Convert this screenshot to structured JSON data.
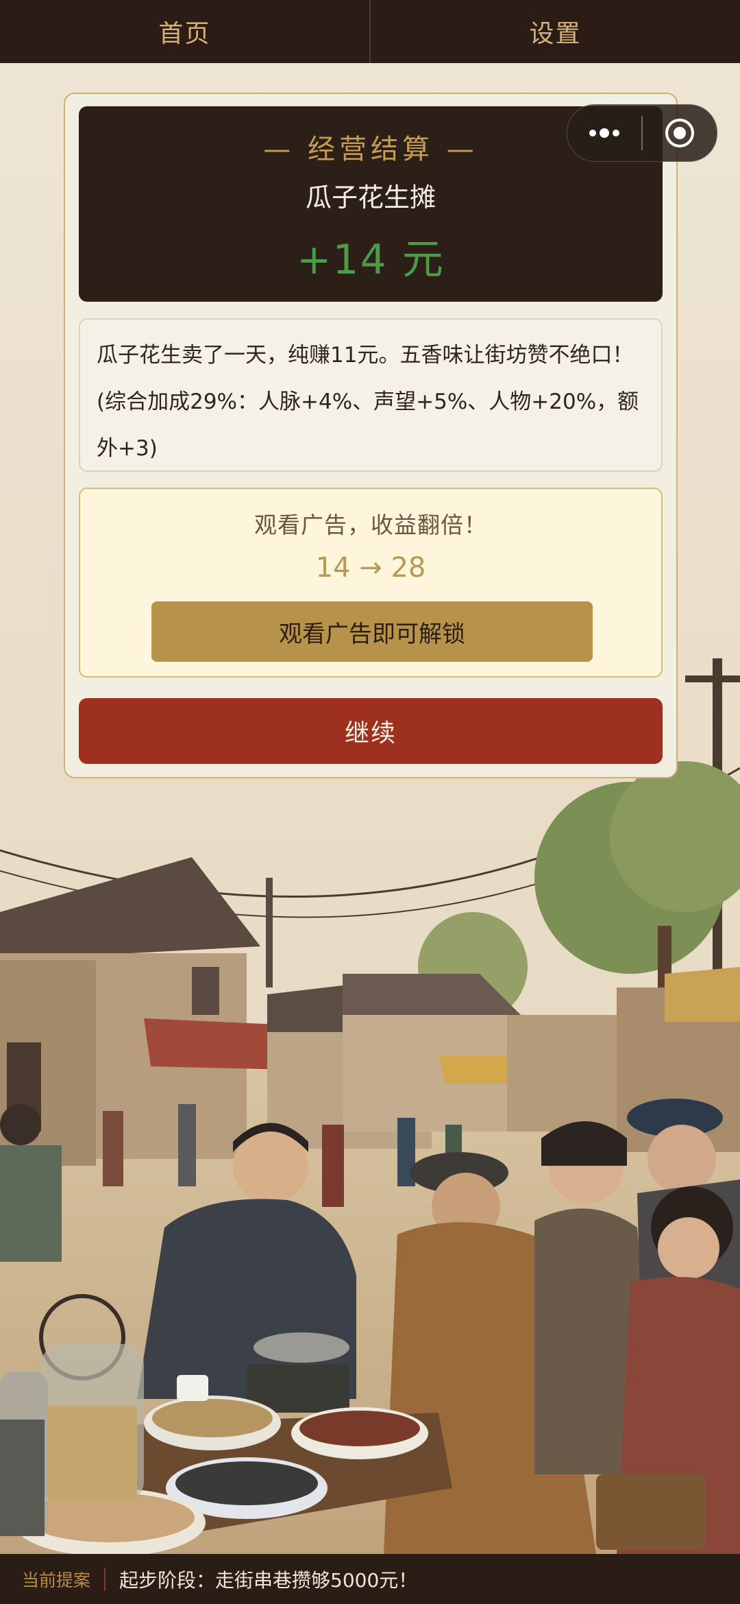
{
  "nav": {
    "home": "首页",
    "settings": "设置"
  },
  "result": {
    "kicker": "— 经营结算 —",
    "stall": "瓜子花生摊",
    "amount": "+14 元",
    "description": "瓜子花生卖了一天，纯赚11元。五香味让街坊赞不绝口！(综合加成29%：人脉+4%、声望+5%、人物+20%，额外+3)"
  },
  "ad": {
    "title": "观看广告，收益翻倍！",
    "calc": "14 → 28",
    "button": "观看广告即可解锁"
  },
  "continue_label": "继续",
  "capsule": {
    "more_icon": "more-dots-icon",
    "close_icon": "target-circle-icon"
  },
  "bottom": {
    "label": "当前提案",
    "text": "起步阶段：走街串巷攒够5000元！"
  },
  "colors": {
    "nav_bg": "#2b1d16",
    "gold": "#c79b52",
    "profit_green": "#4f9a4a",
    "continue_red": "#9e3020",
    "ad_button": "#b6924a"
  }
}
